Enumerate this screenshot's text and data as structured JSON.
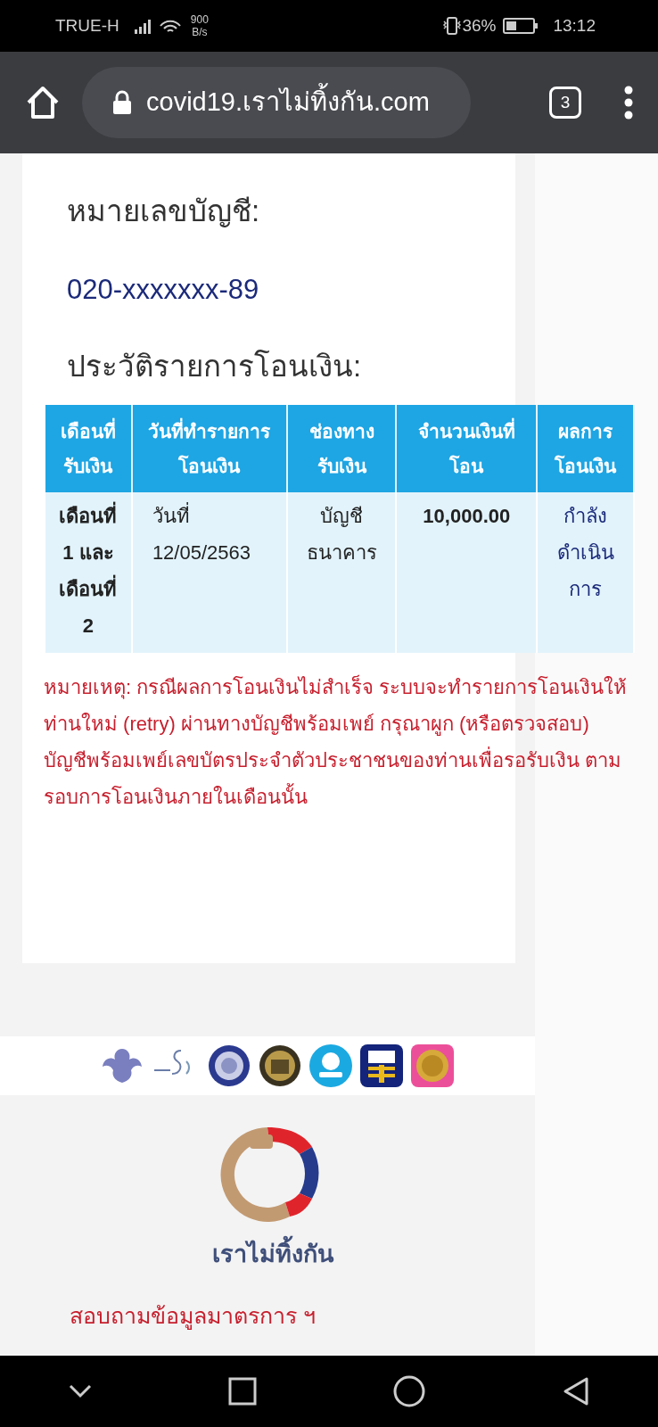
{
  "status_bar": {
    "carrier": "TRUE-H",
    "speed_value": "900",
    "speed_unit": "B/s",
    "battery": "36%",
    "time": "13:12"
  },
  "browser": {
    "url": "covid19.เราไม่ทิ้งกัน.com",
    "tab_count": "3"
  },
  "account": {
    "label": "หมายเลขบัญชี:",
    "number": "020-xxxxxxx-89"
  },
  "history": {
    "title": "ประวัติรายการโอนเงิน:",
    "table": {
      "columns": [
        "เดือนที่รับเงิน",
        "วันที่ทำรายการโอนเงิน",
        "ช่องทางรับเงิน",
        "จำนวนเงินที่โอน",
        "ผลการโอนเงิน"
      ],
      "rows": [
        [
          "เดือนที่ 1 และเดือนที่ 2",
          "วันที่ 12/05/2563",
          "บัญชีธนาคาร",
          "10,000.00",
          "กำลังดำเนินการ"
        ]
      ]
    },
    "note": "หมายเหตุ: กรณีผลการโอนเงินไม่สำเร็จ ระบบจะทำรายการโอนเงินให้ท่านใหม่ (retry) ผ่านทางบัญชีพร้อมเพย์ กรุณาผูก (หรือตรวจสอบ) บัญชีพร้อมเพย์เลขบัตรประจำตัวประชาชนของท่านเพื่อรอรับเงิน ตามรอบการโอนเงินภายในเดือนนั้น"
  },
  "footer": {
    "logo_caption": "เราไม่ทิ้งกัน",
    "link": "สอบถามข้อมูลมาตรการ ฯ"
  }
}
